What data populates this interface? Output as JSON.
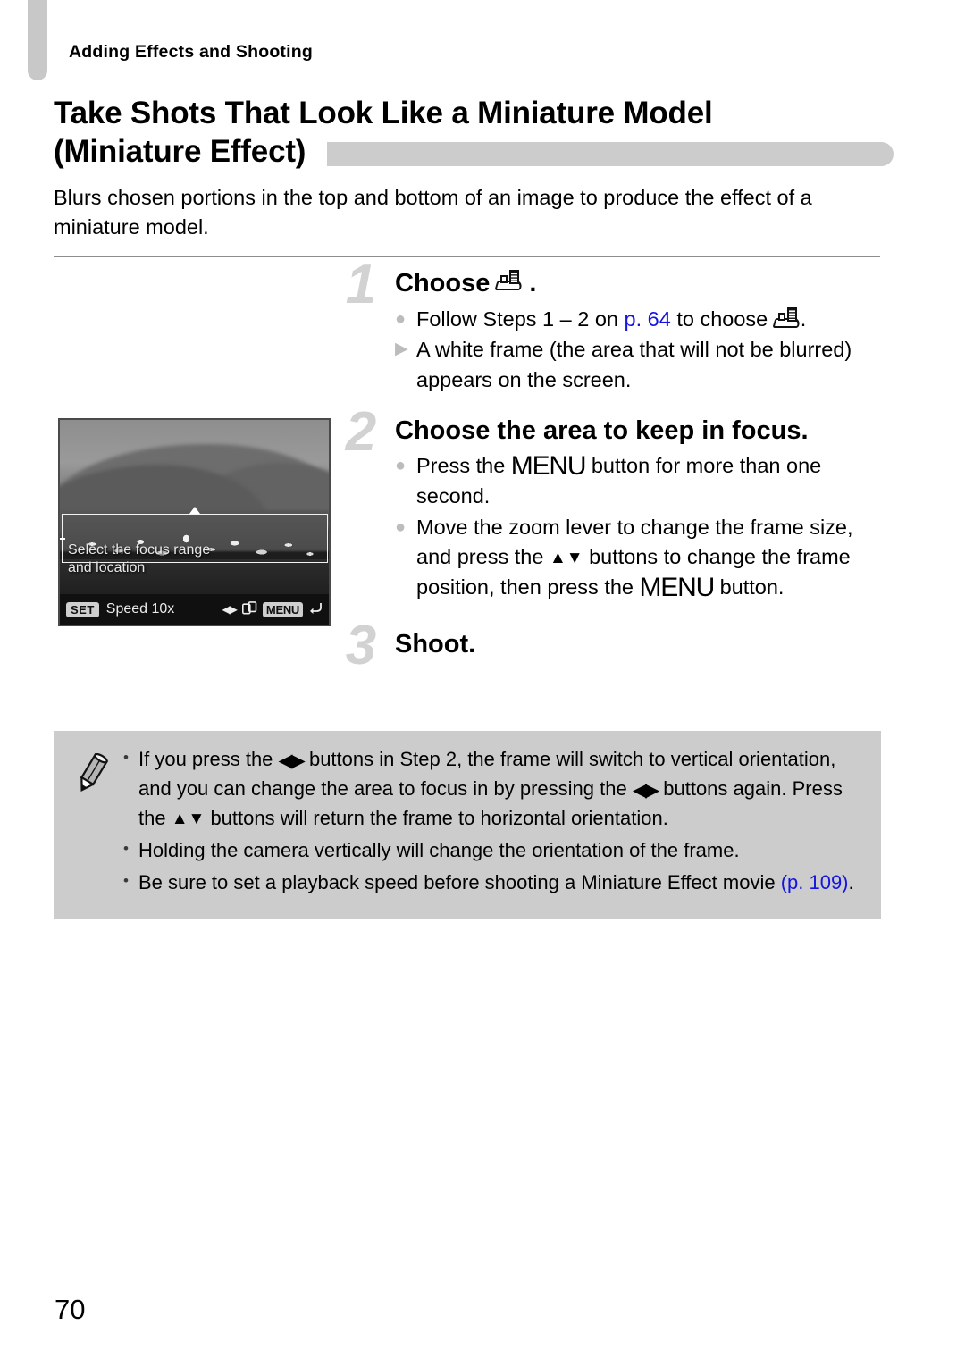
{
  "page": {
    "running_header": "Adding Effects and Shooting",
    "page_number": "70",
    "link_color": "#1414e0",
    "accent_gray": "#cccccc"
  },
  "title": {
    "line1": "Take Shots That Look Like a Miniature Model",
    "line2": "(Miniature Effect)"
  },
  "intro": "Blurs chosen portions in the top and bottom of an image to produce the effect of a miniature model.",
  "camera_screen": {
    "instruction_line1": "Select the focus range",
    "instruction_line2": "and location",
    "set_key": "SET",
    "speed_label": "Speed 10x",
    "lr_arrows": "◀▶",
    "switch_icon": "switch-orientation-icon",
    "menu_key": "MENU",
    "return_icon": "↰"
  },
  "steps": [
    {
      "number": "1",
      "title_prefix": "Choose",
      "title_suffix": ".",
      "title_icon": "miniature-effect-mode-icon",
      "lines": [
        {
          "marker": "dot",
          "segments": [
            {
              "type": "text",
              "value": "Follow Steps 1 – 2 on "
            },
            {
              "type": "link",
              "value": "p. 64"
            },
            {
              "type": "text",
              "value": " to choose "
            },
            {
              "type": "icon",
              "value": "miniature-effect-mode-icon"
            },
            {
              "type": "text",
              "value": "."
            }
          ]
        },
        {
          "marker": "triangle",
          "segments": [
            {
              "type": "text",
              "value": "A white frame (the area that will not be blurred) appears on the screen."
            }
          ]
        }
      ]
    },
    {
      "number": "2",
      "title_prefix": "Choose the area to keep in focus.",
      "title_suffix": "",
      "title_icon": "",
      "lines": [
        {
          "marker": "dot",
          "segments": [
            {
              "type": "text",
              "value": "Press the "
            },
            {
              "type": "menu",
              "value": "MENU"
            },
            {
              "type": "text",
              "value": " button for more than one second."
            }
          ]
        },
        {
          "marker": "dot",
          "segments": [
            {
              "type": "text",
              "value": "Move the zoom lever to change the frame size, and press the "
            },
            {
              "type": "updown",
              "value": "▲▼"
            },
            {
              "type": "text",
              "value": " buttons to change the frame position, then press the "
            },
            {
              "type": "menu",
              "value": "MENU"
            },
            {
              "type": "text",
              "value": " button."
            }
          ]
        }
      ]
    },
    {
      "number": "3",
      "title_prefix": "Shoot.",
      "title_suffix": "",
      "title_icon": "",
      "lines": []
    }
  ],
  "note": {
    "icon": "pencil-icon",
    "items": [
      {
        "segments": [
          {
            "type": "text",
            "value": "If you press the "
          },
          {
            "type": "leftright",
            "value": "◀▶"
          },
          {
            "type": "text",
            "value": " buttons in Step 2, the frame will switch to vertical orientation, and you can change the area to focus in by pressing the "
          },
          {
            "type": "leftright",
            "value": "◀▶"
          },
          {
            "type": "text",
            "value": " buttons again. Press the "
          },
          {
            "type": "updown",
            "value": "▲▼"
          },
          {
            "type": "text",
            "value": " buttons will return the frame to horizontal orientation."
          }
        ]
      },
      {
        "segments": [
          {
            "type": "text",
            "value": "Holding the camera vertically will change the orientation of the frame."
          }
        ]
      },
      {
        "segments": [
          {
            "type": "text",
            "value": "Be sure to set a playback speed before shooting a Miniature Effect movie "
          },
          {
            "type": "link",
            "value": "(p. 109)"
          },
          {
            "type": "text",
            "value": "."
          }
        ]
      }
    ]
  }
}
